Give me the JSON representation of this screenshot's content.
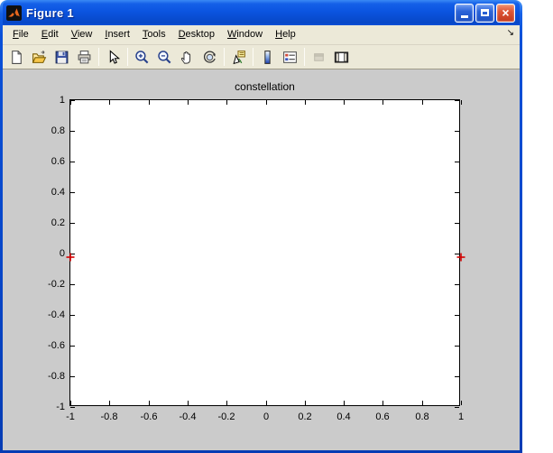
{
  "window": {
    "title": "Figure 1",
    "app_icon": "matlab-logo",
    "buttons": {
      "minimize": "minimize",
      "maximize": "maximize",
      "close": "close"
    }
  },
  "menubar": {
    "items": [
      {
        "label": "File",
        "underline": 0
      },
      {
        "label": "Edit",
        "underline": 0
      },
      {
        "label": "View",
        "underline": 0
      },
      {
        "label": "Insert",
        "underline": 0
      },
      {
        "label": "Tools",
        "underline": 0
      },
      {
        "label": "Desktop",
        "underline": 0
      },
      {
        "label": "Window",
        "underline": 0
      },
      {
        "label": "Help",
        "underline": 0
      }
    ],
    "overflow_icon": "menu-overflow-arrow",
    "overflow_glyph": "↘"
  },
  "toolbar": {
    "groups": [
      [
        {
          "name": "new-figure"
        },
        {
          "name": "open-file"
        },
        {
          "name": "save-figure"
        },
        {
          "name": "print-figure"
        }
      ],
      [
        {
          "name": "edit-plot"
        }
      ],
      [
        {
          "name": "zoom-in"
        },
        {
          "name": "zoom-out"
        },
        {
          "name": "pan"
        },
        {
          "name": "rotate-3d"
        }
      ],
      [
        {
          "name": "data-cursor"
        }
      ],
      [
        {
          "name": "insert-colorbar"
        },
        {
          "name": "insert-legend"
        }
      ],
      [
        {
          "name": "hide-plot-tools",
          "disabled": true
        },
        {
          "name": "show-plot-tools"
        }
      ]
    ]
  },
  "colors": {
    "titlebar_blue": "#0b54e0",
    "close_red": "#dd5636",
    "menubar_beige": "#ece9d8",
    "figure_gray": "#cbcbcb",
    "marker_red": "#d40000",
    "axes_background": "#ffffff"
  },
  "chart_data": {
    "type": "scatter",
    "title": "constellation",
    "points": [
      {
        "x": -1,
        "y": 0
      },
      {
        "x": 1,
        "y": 0
      }
    ],
    "marker": {
      "shape": "plus",
      "color": "#d40000"
    },
    "xlim": [
      -1,
      1
    ],
    "ylim": [
      -1,
      1
    ],
    "x_ticks": [
      "-1",
      "-0.8",
      "-0.6",
      "-0.4",
      "-0.2",
      "0",
      "0.2",
      "0.4",
      "0.6",
      "0.8",
      "1"
    ],
    "y_ticks": [
      "1",
      "0.8",
      "0.6",
      "0.4",
      "0.2",
      "0",
      "-0.2",
      "-0.4",
      "-0.6",
      "-0.8",
      "-1"
    ],
    "grid": false,
    "box": true,
    "legend": null
  }
}
